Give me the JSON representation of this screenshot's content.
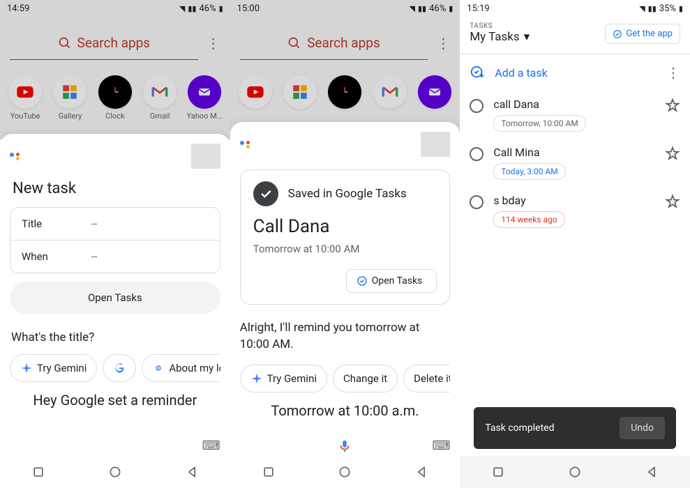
{
  "screen1": {
    "status": {
      "time": "14:59",
      "battery": "46%"
    },
    "search_placeholder": "Search apps",
    "apps": [
      {
        "label": "YouTube"
      },
      {
        "label": "Gallery"
      },
      {
        "label": "Clock"
      },
      {
        "label": "Gmail"
      },
      {
        "label": "Yahoo M..."
      }
    ],
    "card": {
      "heading": "New task",
      "fields": {
        "title_label": "Title",
        "title_value": "--",
        "when_label": "When",
        "when_value": "--"
      },
      "open_tasks": "Open Tasks"
    },
    "prompt": "What's the title?",
    "chips": {
      "gemini": "Try Gemini",
      "about": "About my lo"
    },
    "transcript": "Hey Google set a reminder"
  },
  "screen2": {
    "status": {
      "time": "15:00",
      "battery": "46%"
    },
    "search_placeholder": "Search apps",
    "card": {
      "saved_in": "Saved in Google Tasks",
      "title": "Call Dana",
      "time": "Tomorrow at 10:00 AM",
      "open_tasks": "Open Tasks"
    },
    "response": "Alright, I'll remind you tomorrow at 10:00 AM.",
    "chips": {
      "gemini": "Try Gemini",
      "change": "Change it",
      "delete": "Delete it"
    },
    "transcript": "Tomorrow at 10:00 a.m."
  },
  "screen3": {
    "status": {
      "time": "15:19",
      "battery": "35%"
    },
    "header": {
      "tiny": "TASKS",
      "list_name": "My Tasks",
      "get_app": "Get the app"
    },
    "add_task": "Add a task",
    "tasks": [
      {
        "title": "call Dana",
        "badge": "Tomorrow, 10:00 AM",
        "badge_class": "grey"
      },
      {
        "title": "Call Mina",
        "badge": "Today, 3:00 AM",
        "badge_class": "blue"
      },
      {
        "title_prefix": "   ",
        "title_suffix": "s bday",
        "badge": "114 weeks ago",
        "badge_class": "red"
      }
    ],
    "snackbar": {
      "text": "Task completed",
      "action": "Undo"
    }
  }
}
